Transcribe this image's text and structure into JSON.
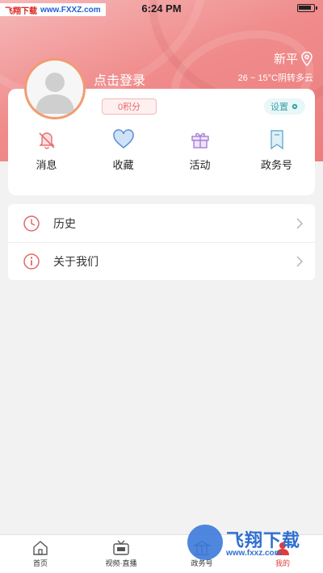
{
  "status_bar": {
    "time": "6:24 PM"
  },
  "watermark_top": {
    "part1": "飞翔下载",
    "part2": "www.FXXZ.com"
  },
  "location": {
    "city": "新平",
    "weather": "26 ~ 15°C阴转多云"
  },
  "profile": {
    "login_text": "点击登录",
    "points": "0积分",
    "settings": "设置"
  },
  "quick_actions": [
    {
      "label": "消息",
      "icon": "bell-off-icon"
    },
    {
      "label": "收藏",
      "icon": "heart-icon"
    },
    {
      "label": "活动",
      "icon": "gift-icon"
    },
    {
      "label": "政务号",
      "icon": "bookmark-icon"
    }
  ],
  "menu": [
    {
      "label": "历史",
      "icon": "clock-icon"
    },
    {
      "label": "关于我们",
      "icon": "info-icon"
    }
  ],
  "tabs": [
    {
      "label": "首页",
      "icon": "home-icon"
    },
    {
      "label": "视频·直播",
      "icon": "tv-icon"
    },
    {
      "label": "政务号",
      "icon": "government-icon"
    },
    {
      "label": "我的",
      "icon": "profile-icon",
      "active": true
    }
  ],
  "watermark_bottom": {
    "brand": "飞翔下载",
    "url": "www.fxxz.com"
  },
  "colors": {
    "accent": "#e23b3b",
    "hero": "#f08c8c",
    "settings": "#3fa0a8"
  }
}
